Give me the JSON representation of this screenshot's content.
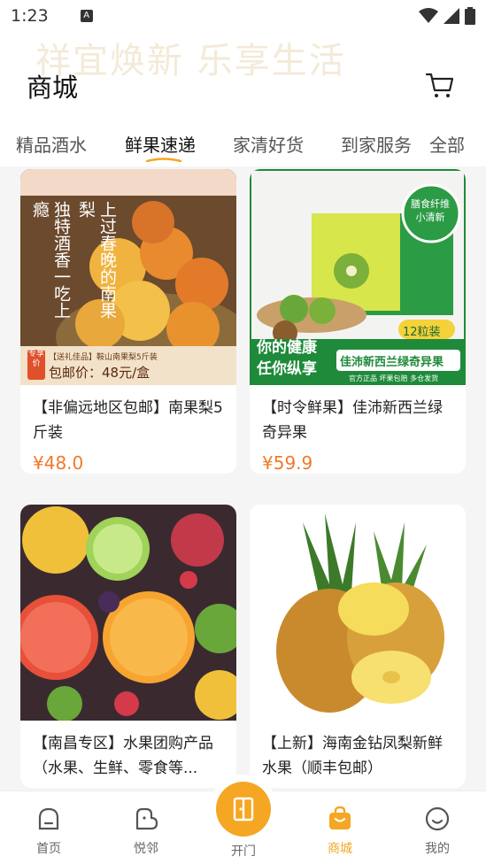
{
  "status": {
    "time": "1:23",
    "noti": "A"
  },
  "header": {
    "title": "商城",
    "watermark": "祥宜焕新 乐享生活"
  },
  "tabs": [
    {
      "label": "精品酒水"
    },
    {
      "label": "鲜果速递"
    },
    {
      "label": "家清好货"
    },
    {
      "label": "到家服务"
    },
    {
      "label": "全部"
    }
  ],
  "products": [
    {
      "name": "【非偏远地区包邮】南果梨5斤装",
      "price": "¥48.0",
      "img": {
        "vertical1": "上过春晚的南果梨",
        "vertical2": "独特酒香一吃上瘾",
        "tag": "专享价",
        "sub": "【送礼佳品】鞍山南果梨5斤装",
        "postage": "包邮价：48元/盒"
      }
    },
    {
      "name": "【时令鲜果】佳沛新西兰绿奇异果",
      "price": "¥59.9",
      "img": {
        "badge": "膳食纤维 小清新",
        "count": "12粒装",
        "slogan1": "你的健康",
        "slogan2": "任你纵享",
        "banner": "佳沛新西兰绿奇异果",
        "tags": "官方正品  坏果包赔  多仓发货"
      }
    },
    {
      "name": "【南昌专区】水果团购产品（水果、生鲜、零食等...",
      "price": ""
    },
    {
      "name": "【上新】海南金钻凤梨新鲜水果（顺丰包邮）",
      "price": ""
    }
  ],
  "nav": [
    {
      "label": "首页"
    },
    {
      "label": "悦邻"
    },
    {
      "label": "开门"
    },
    {
      "label": "商城"
    },
    {
      "label": "我的"
    }
  ],
  "colors": {
    "accent": "#f5a623",
    "price": "#f07a2b",
    "kiwi_green": "#1e8a3a"
  }
}
